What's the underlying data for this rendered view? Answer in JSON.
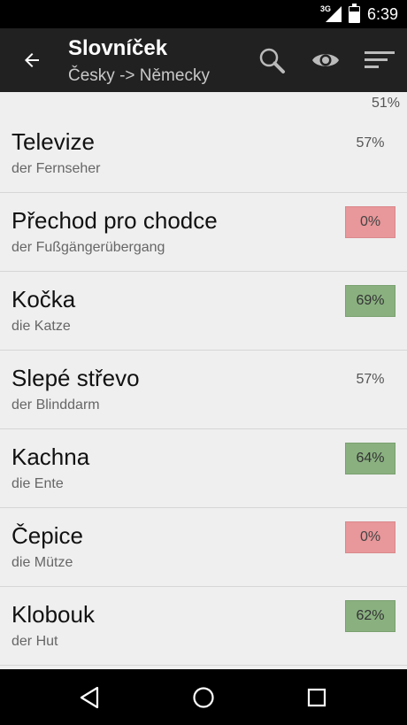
{
  "status_bar": {
    "network": "3G",
    "time": "6:39"
  },
  "app_bar": {
    "title": "Slovníček",
    "subtitle": "Česky -> Německy"
  },
  "overall_percent": "51%",
  "items": [
    {
      "word": "Televize",
      "translation": "der Fernseher",
      "percent": "57%",
      "status": "neutral"
    },
    {
      "word": "Přechod pro chodce",
      "translation": "der Fußgängerübergang",
      "percent": "0%",
      "status": "red"
    },
    {
      "word": "Kočka",
      "translation": "die Katze",
      "percent": "69%",
      "status": "green"
    },
    {
      "word": "Slepé střevo",
      "translation": "der Blinddarm",
      "percent": "57%",
      "status": "neutral"
    },
    {
      "word": "Kachna",
      "translation": "die Ente",
      "percent": "64%",
      "status": "green"
    },
    {
      "word": "Čepice",
      "translation": "die Mütze",
      "percent": "0%",
      "status": "red"
    },
    {
      "word": "Klobouk",
      "translation": "der Hut",
      "percent": "62%",
      "status": "green"
    }
  ],
  "colors": {
    "red_badge": "#e8979a",
    "green_badge": "#8ab080",
    "app_bar": "#212121"
  }
}
